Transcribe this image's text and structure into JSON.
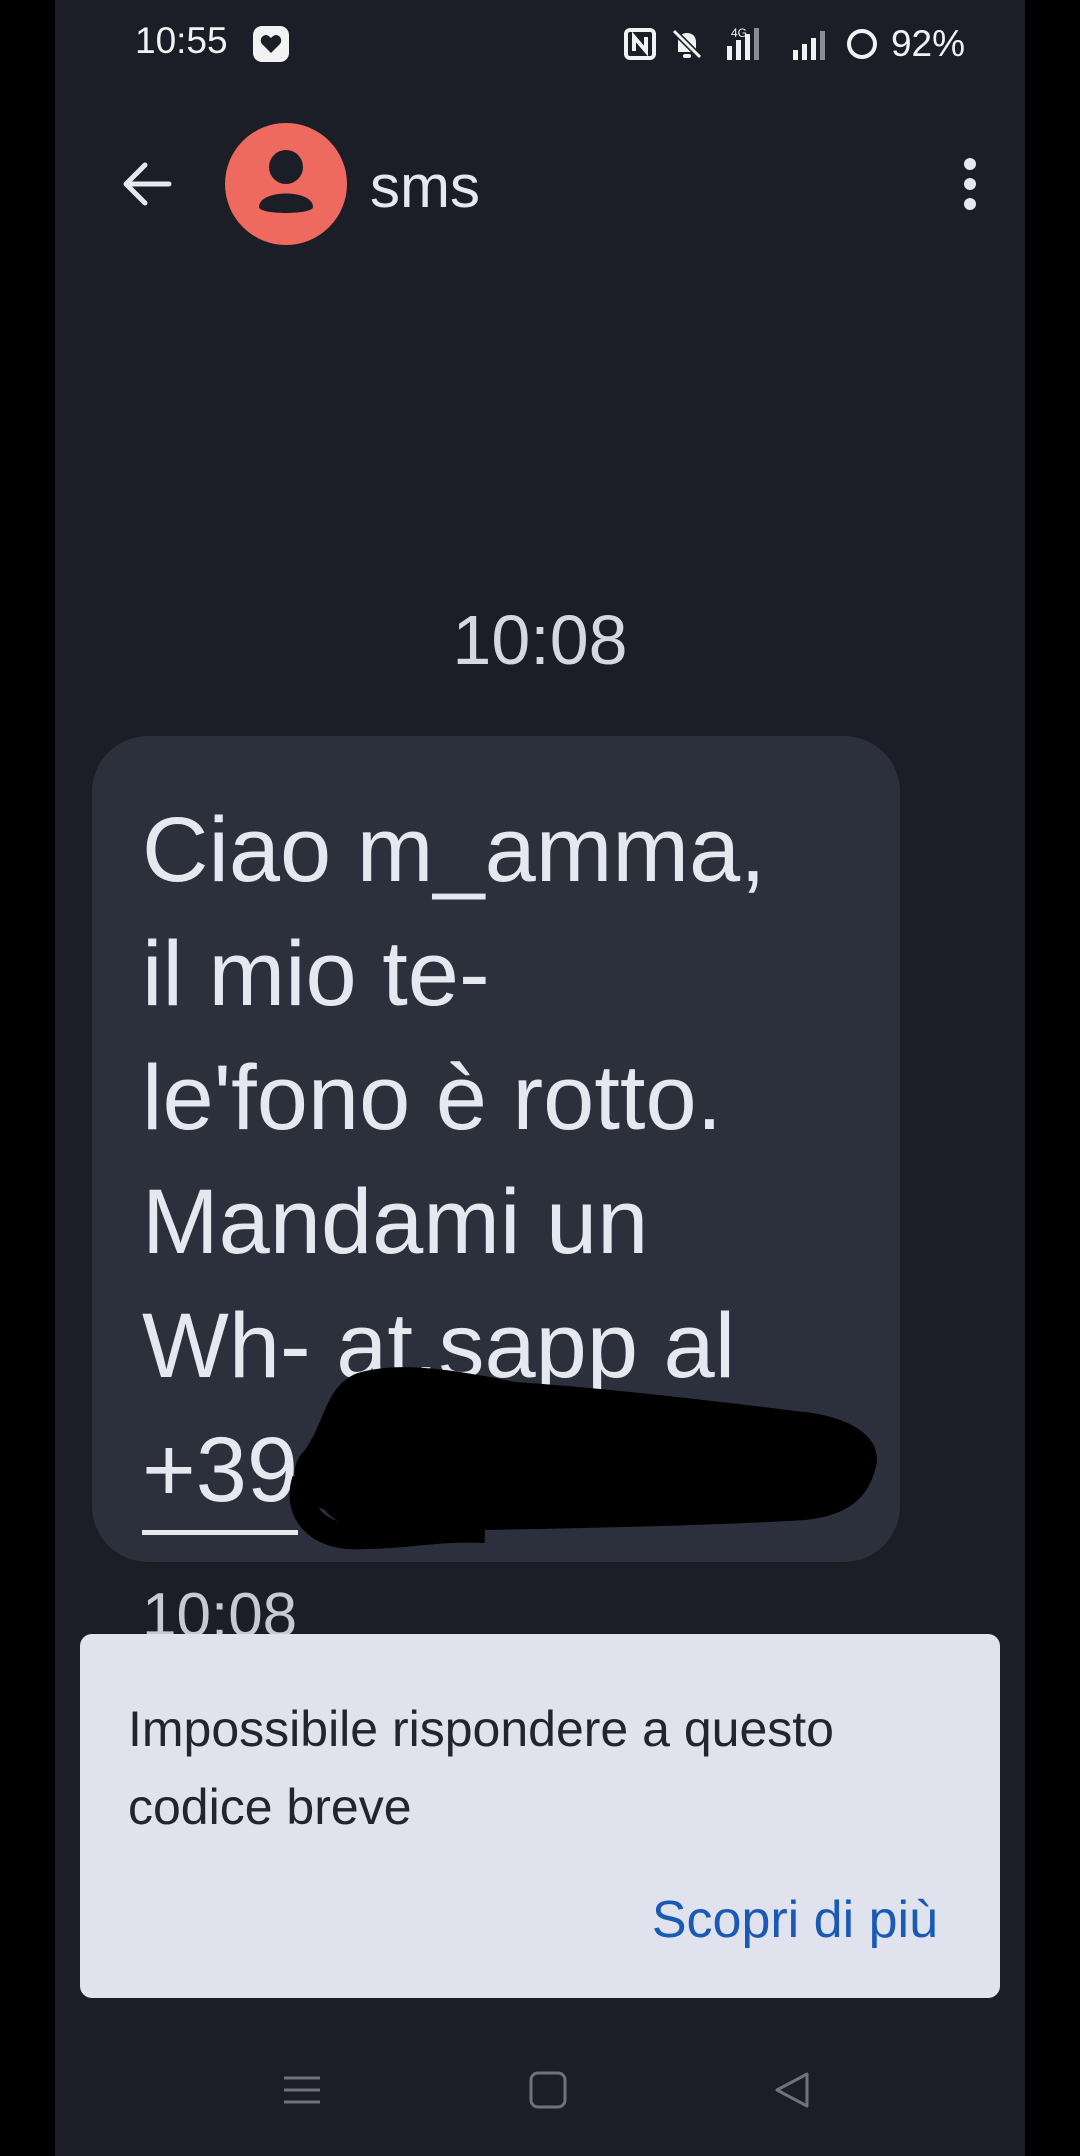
{
  "status_bar": {
    "time": "10:55",
    "battery": "92%",
    "network": "4G",
    "icons": [
      "heart-app-icon",
      "nfc-icon",
      "mute-icon",
      "signal-icon",
      "signal-icon",
      "battery-icon"
    ]
  },
  "header": {
    "contact_name": "sms",
    "back_icon": "arrow-left-icon",
    "menu_icon": "more-vert-icon",
    "avatar_color": "#ee6a5f"
  },
  "conversation": {
    "timestamp_top": "10:08",
    "message": {
      "text": "Ciao m_amma,\nil mio te-\nle'fono è rotto.\nMandami un\nWh- at,sapp al",
      "number_prefix": "+39",
      "time": "10:08"
    }
  },
  "info_card": {
    "text": "Impossibile rispondere a questo codice breve",
    "link": "Scopri di più",
    "link_color": "#1a5ab4"
  },
  "nav_bar": {
    "icons": [
      "recents-icon",
      "home-icon",
      "back-triangle-icon"
    ]
  }
}
